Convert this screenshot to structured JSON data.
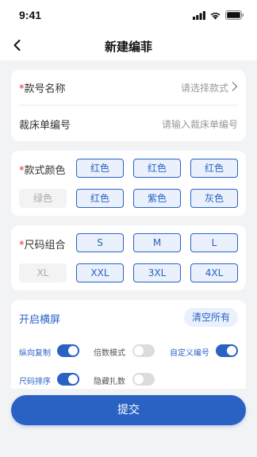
{
  "status_bar": {
    "time": "9:41",
    "icons": [
      "signal-icon",
      "wifi-icon",
      "battery-icon"
    ]
  },
  "nav": {
    "title": "新建编菲",
    "back_icon": "chevron-left-icon"
  },
  "style_field": {
    "required_mark": "*",
    "label": "款号名称",
    "placeholder": "请选择款式"
  },
  "bed_field": {
    "label": "裁床单编号",
    "placeholder": "请输入裁床单编号"
  },
  "colors": {
    "required_mark": "*",
    "label": "款式颜色",
    "row1": [
      "红色",
      "红色",
      "红色"
    ],
    "base": "绿色",
    "row2": [
      "红色",
      "紫色",
      "灰色"
    ]
  },
  "sizes": {
    "required_mark": "*",
    "label": "尺码组合",
    "row1": [
      "S",
      "M",
      "L"
    ],
    "base": "XL",
    "row2": [
      "XXL",
      "3XL",
      "4XL"
    ]
  },
  "settings": {
    "title": "开启横屏",
    "clear_label": "清空所有",
    "options": [
      {
        "label": "纵向复制",
        "on": true
      },
      {
        "label": "倍数模式",
        "on": false
      },
      {
        "label": "自定义编号",
        "on": true
      },
      {
        "label": "尺码排序",
        "on": true
      },
      {
        "label": "隐藏扎数",
        "on": false
      }
    ]
  },
  "submit_label": "提交",
  "theme": {
    "accent": "#2a62c4",
    "chip_bg": "#eaf1fd",
    "required": "#e0302a",
    "page_bg": "#f2f3f5"
  }
}
